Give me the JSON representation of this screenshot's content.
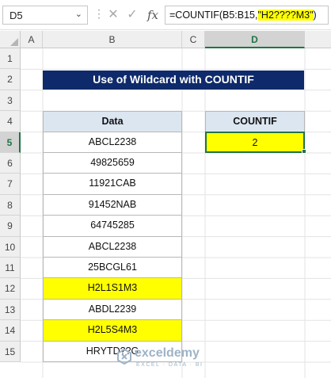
{
  "formula_bar": {
    "name_box": "D5",
    "formula_prefix": "=COUNTIF(B5:B15,",
    "formula_highlight": "\"H2????M3\"",
    "formula_suffix": ")",
    "fx_label": "fx"
  },
  "columns": [
    "A",
    "B",
    "C",
    "D"
  ],
  "rows": [
    "1",
    "2",
    "3",
    "4",
    "5",
    "6",
    "7",
    "8",
    "9",
    "10",
    "11",
    "12",
    "13",
    "14",
    "15"
  ],
  "selected_column": "D",
  "selected_row": "5",
  "title": "Use of Wildcard with COUNTIF",
  "data_table": {
    "header": "Data",
    "values": [
      "ABCL2238",
      "49825659",
      "11921CAB",
      "91452NAB",
      "64745285",
      "ABCL2238",
      "25BCGL61",
      "H2L1S1M3",
      "ABDL2239",
      "H2L5S4M3",
      "HRYTD??G"
    ],
    "highlighted": [
      false,
      false,
      false,
      false,
      false,
      false,
      false,
      true,
      false,
      true,
      false
    ]
  },
  "result_table": {
    "header": "COUNTIF",
    "value": "2"
  },
  "colors": {
    "title_bg": "#0e2a6b",
    "header_bg": "#dce6f1",
    "highlight": "#ffff00",
    "excel_green": "#217346"
  },
  "watermark": {
    "name": "exceldemy",
    "tagline": "EXCEL · DATA · BI"
  }
}
